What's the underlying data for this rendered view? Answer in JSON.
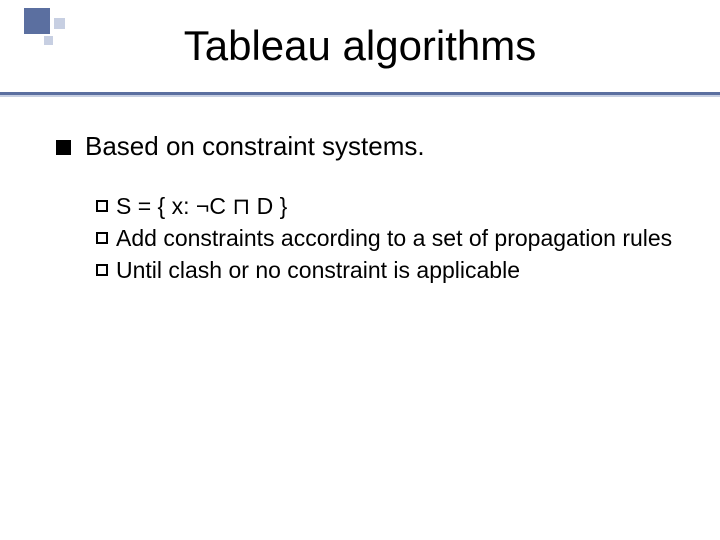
{
  "title": "Tableau algorithms",
  "body": {
    "item1": "Based on constraint systems.",
    "sub1": "S  = { x: ¬C ⊓ D }",
    "sub2": "Add constraints according to a set of propagation rules",
    "sub3": "Until clash or no constraint is applicable"
  }
}
